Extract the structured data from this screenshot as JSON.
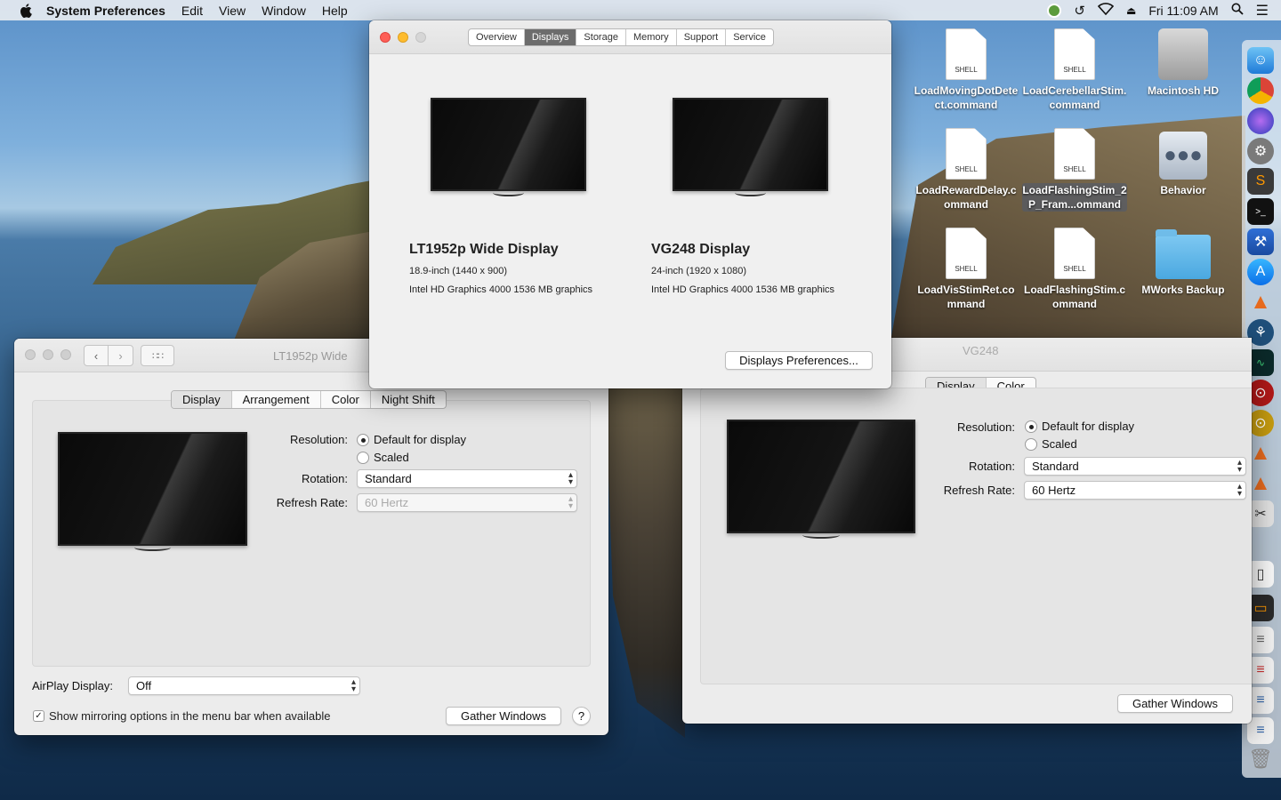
{
  "menubar": {
    "app_name": "System Preferences",
    "menus": [
      "Edit",
      "View",
      "Window",
      "Help"
    ],
    "clock": "Fri 11:09 AM"
  },
  "about_window": {
    "segments": [
      "Overview",
      "Displays",
      "Storage",
      "Memory",
      "Support",
      "Service"
    ],
    "selected_segment": "Displays",
    "displays": [
      {
        "name": "LT1952p Wide Display",
        "size": "18.9-inch (1440 x 900)",
        "graphics": "Intel HD Graphics 4000 1536 MB graphics"
      },
      {
        "name": "VG248 Display",
        "size": "24-inch (1920 x 1080)",
        "graphics": "Intel HD Graphics 4000 1536 MB graphics"
      }
    ],
    "prefs_button": "Displays Preferences..."
  },
  "lt_window": {
    "title": "LT1952p Wide",
    "tabs": [
      "Display",
      "Arrangement",
      "Color",
      "Night Shift"
    ],
    "resolution_label": "Resolution:",
    "res_default": "Default for display",
    "res_scaled": "Scaled",
    "rotation_label": "Rotation:",
    "rotation_value": "Standard",
    "refresh_label": "Refresh Rate:",
    "refresh_value": "60 Hertz",
    "airplay_label": "AirPlay Display:",
    "airplay_value": "Off",
    "mirroring_label": "Show mirroring options in the menu bar when available",
    "gather_button": "Gather Windows",
    "help_button": "?"
  },
  "vg_window": {
    "title": "VG248",
    "tabs": [
      "Display",
      "Color"
    ],
    "resolution_label": "Resolution:",
    "res_default": "Default for display",
    "res_scaled": "Scaled",
    "rotation_label": "Rotation:",
    "rotation_value": "Standard",
    "refresh_label": "Refresh Rate:",
    "refresh_value": "60 Hertz",
    "gather_button": "Gather Windows"
  },
  "desktop": {
    "shell_tag": "SHELL",
    "icons": [
      {
        "label": "LoadMovingDotDetect.command"
      },
      {
        "label": "LoadCerebellarStim.command"
      },
      {
        "label": "Macintosh HD"
      },
      {
        "label": "LoadRewardDelay.command"
      },
      {
        "label": "LoadFlashingStim_2P_Fram...ommand"
      },
      {
        "label": "Behavior"
      },
      {
        "label": "LoadVisStimRet.command"
      },
      {
        "label": "LoadFlashingStim.command"
      },
      {
        "label": "MWorks Backup"
      }
    ]
  }
}
